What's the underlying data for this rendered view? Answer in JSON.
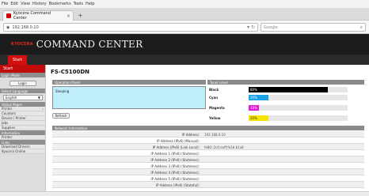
{
  "browser": {
    "menu": [
      "File",
      "Edit",
      "View",
      "History",
      "Bookmarks",
      "Tools",
      "Help"
    ],
    "tab_title": "Kyocera Command Center",
    "url": "192.168.0.10",
    "search_placeholder": "Google"
  },
  "app": {
    "brand": "KYOCERA",
    "title": "COMMAND CENTER",
    "start_tab": "Start"
  },
  "sidebar": {
    "start": "Start",
    "login_header": "Login Mode",
    "login_button": "Login",
    "language_header": "Select Language",
    "language_value": "English",
    "status_header": "Status Pages",
    "status_items": [
      {
        "label": "Printer",
        "arrow": "›"
      },
      {
        "label": "Counters",
        "arrow": ""
      },
      {
        "label": "Device / Printer",
        "arrow": ""
      },
      {
        "label": "Jobs",
        "arrow": ""
      },
      {
        "label": "Supplies",
        "arrow": ""
      }
    ],
    "info_header": "Information",
    "info_items": [
      {
        "label": "Printer",
        "arrow": ""
      }
    ],
    "links_header": "Links",
    "link_items": [
      {
        "label": "Download Drivers",
        "arrow": ""
      },
      {
        "label": "Kyocera Online",
        "arrow": ""
      }
    ]
  },
  "main": {
    "page_title": "FS-C5100DN",
    "operation_panel_header": "Operation Panel",
    "operation_panel_text": "Sleeping",
    "refresh_button": "Refresh",
    "toner_header": "Toner Level",
    "toner": [
      {
        "name": "Black",
        "percent": 80,
        "label": "80%",
        "color": "#000000"
      },
      {
        "name": "Cyan",
        "percent": 20,
        "label": "20%",
        "color": "#1aa3e8"
      },
      {
        "name": "Magenta",
        "percent": 10,
        "label": "10%",
        "color": "#e21ad6"
      },
      {
        "name": "Yellow",
        "percent": 20,
        "label": "20%",
        "color": "#f5e500"
      }
    ],
    "network_header": "Network Information",
    "network_rows": [
      {
        "label": "IP Address:",
        "value": "192.168.0.10"
      },
      {
        "label": "IP Address (IPv6) (Manual):",
        "value": ""
      },
      {
        "label": "IP Address (IPv6) (Link Local):",
        "value": "fe80::2c0:eeff:fe1b:b1a8"
      },
      {
        "label": "IP Address 1 (IPv6) (Stateless):",
        "value": ""
      },
      {
        "label": "IP Address 2 (IPv6) (Stateless):",
        "value": ""
      },
      {
        "label": "IP Address 3 (IPv6) (Stateless):",
        "value": ""
      },
      {
        "label": "IP Address 4 (IPv6) (Stateless):",
        "value": ""
      },
      {
        "label": "IP Address 5 (IPv6) (Stateless):",
        "value": ""
      },
      {
        "label": "IP Address (IPv6) (Stateful):",
        "value": ""
      }
    ]
  }
}
